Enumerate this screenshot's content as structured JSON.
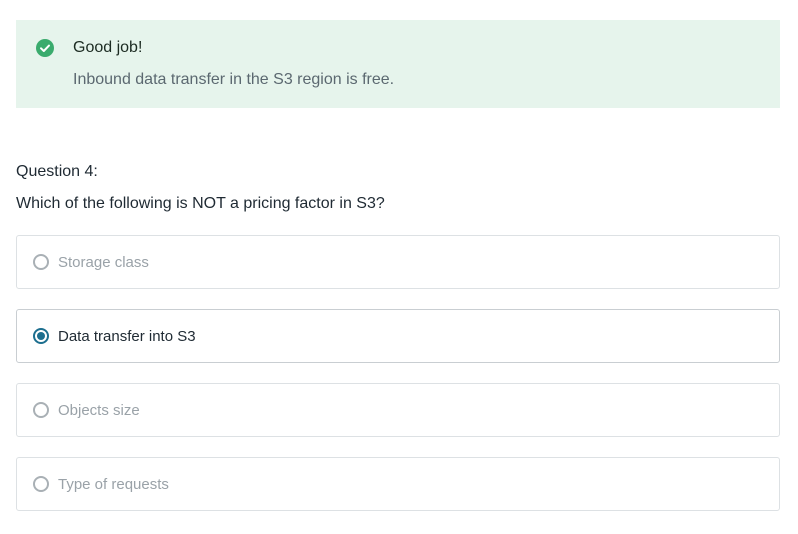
{
  "feedback": {
    "status": "correct",
    "icon": "check-circle-icon",
    "accent_color": "#3aab6d",
    "background_color": "#e6f4ec",
    "title": "Good job!",
    "message": "Inbound data transfer in the S3 region is free."
  },
  "question": {
    "label": "Question 4:",
    "text": "Which of the following is NOT a pricing factor in S3?",
    "options": [
      {
        "label": "Storage class",
        "selected": false
      },
      {
        "label": "Data transfer into S3",
        "selected": true
      },
      {
        "label": "Objects size",
        "selected": false
      },
      {
        "label": "Type of requests",
        "selected": false
      }
    ]
  },
  "colors": {
    "selected_radio": "#1d6f8f",
    "muted_text": "#9aa2a8"
  }
}
